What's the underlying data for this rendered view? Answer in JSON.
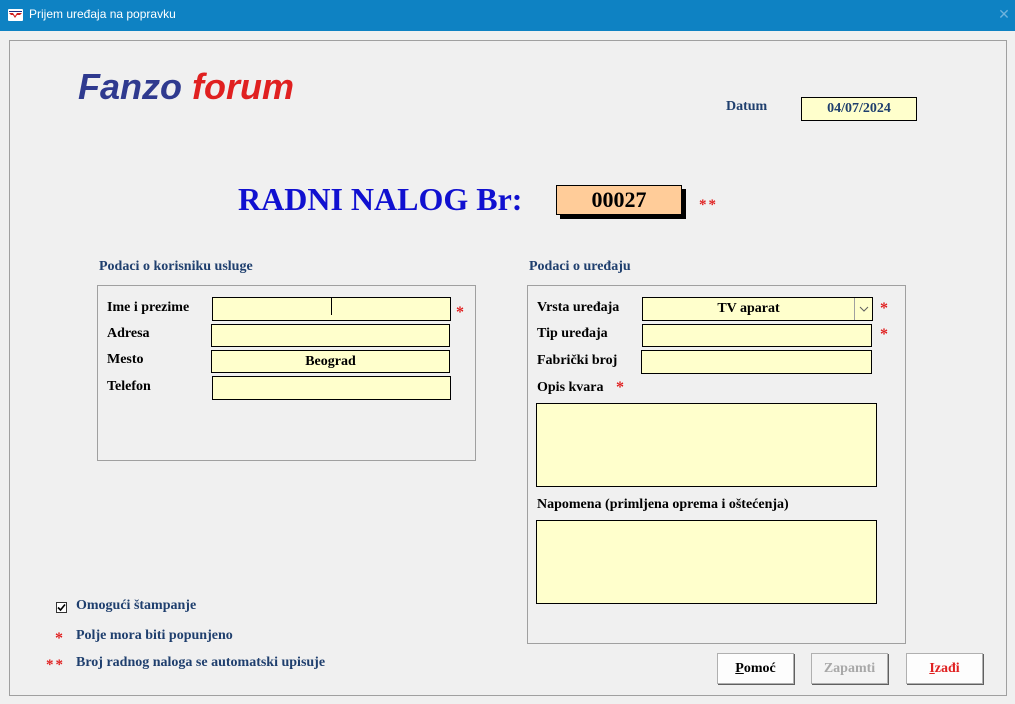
{
  "window": {
    "title": "Prijem uređaja na popravku",
    "close_glyph": "✕"
  },
  "logo": {
    "part1": "Fanzo",
    "part2": "forum"
  },
  "header": {
    "date_label": "Datum",
    "date_value": "04/07/2024"
  },
  "order": {
    "title": "RADNI NALOG Br:",
    "number": "00027",
    "marker": "**"
  },
  "customer": {
    "section_title": "Podaci o korisniku usluge",
    "name_label": "Ime i prezime",
    "name_value": "",
    "address_label": "Adresa",
    "address_value": "",
    "city_label": "Mesto",
    "city_value": "Beograd",
    "phone_label": "Telefon",
    "phone_value": ""
  },
  "device": {
    "section_title": "Podaci o uređaju",
    "type_label": "Vrsta uređaja",
    "type_value": "TV aparat",
    "model_label": "Tip uređaja",
    "model_value": "",
    "serial_label": "Fabrički broj",
    "serial_value": "",
    "fault_label": "Opis kvara",
    "fault_value": "",
    "note_label": "Napomena (primljena oprema i oštećenja)",
    "note_value": ""
  },
  "required_marker": "*",
  "options": {
    "print_enabled_label": "Omogući štampanje",
    "print_enabled": true
  },
  "legend": {
    "single_marker": "*",
    "single_text": "Polje mora biti popunjeno",
    "double_marker": "**",
    "double_text": "Broj radnog naloga se automatski upisuje"
  },
  "buttons": {
    "help": {
      "label": "Pomoć",
      "mnemonic": "P",
      "rest": "omoć"
    },
    "save": {
      "label": "Zapamti"
    },
    "exit": {
      "label": "Izađi",
      "mnemonic": "I",
      "rest": "zađi"
    }
  },
  "colors": {
    "titlebar": "#0e82c3",
    "field_bg": "#ffffcc",
    "order_field_bg": "#ffcc99",
    "required": "#e02020",
    "accent_text": "#1f3f6e",
    "order_title": "#1010d0"
  }
}
